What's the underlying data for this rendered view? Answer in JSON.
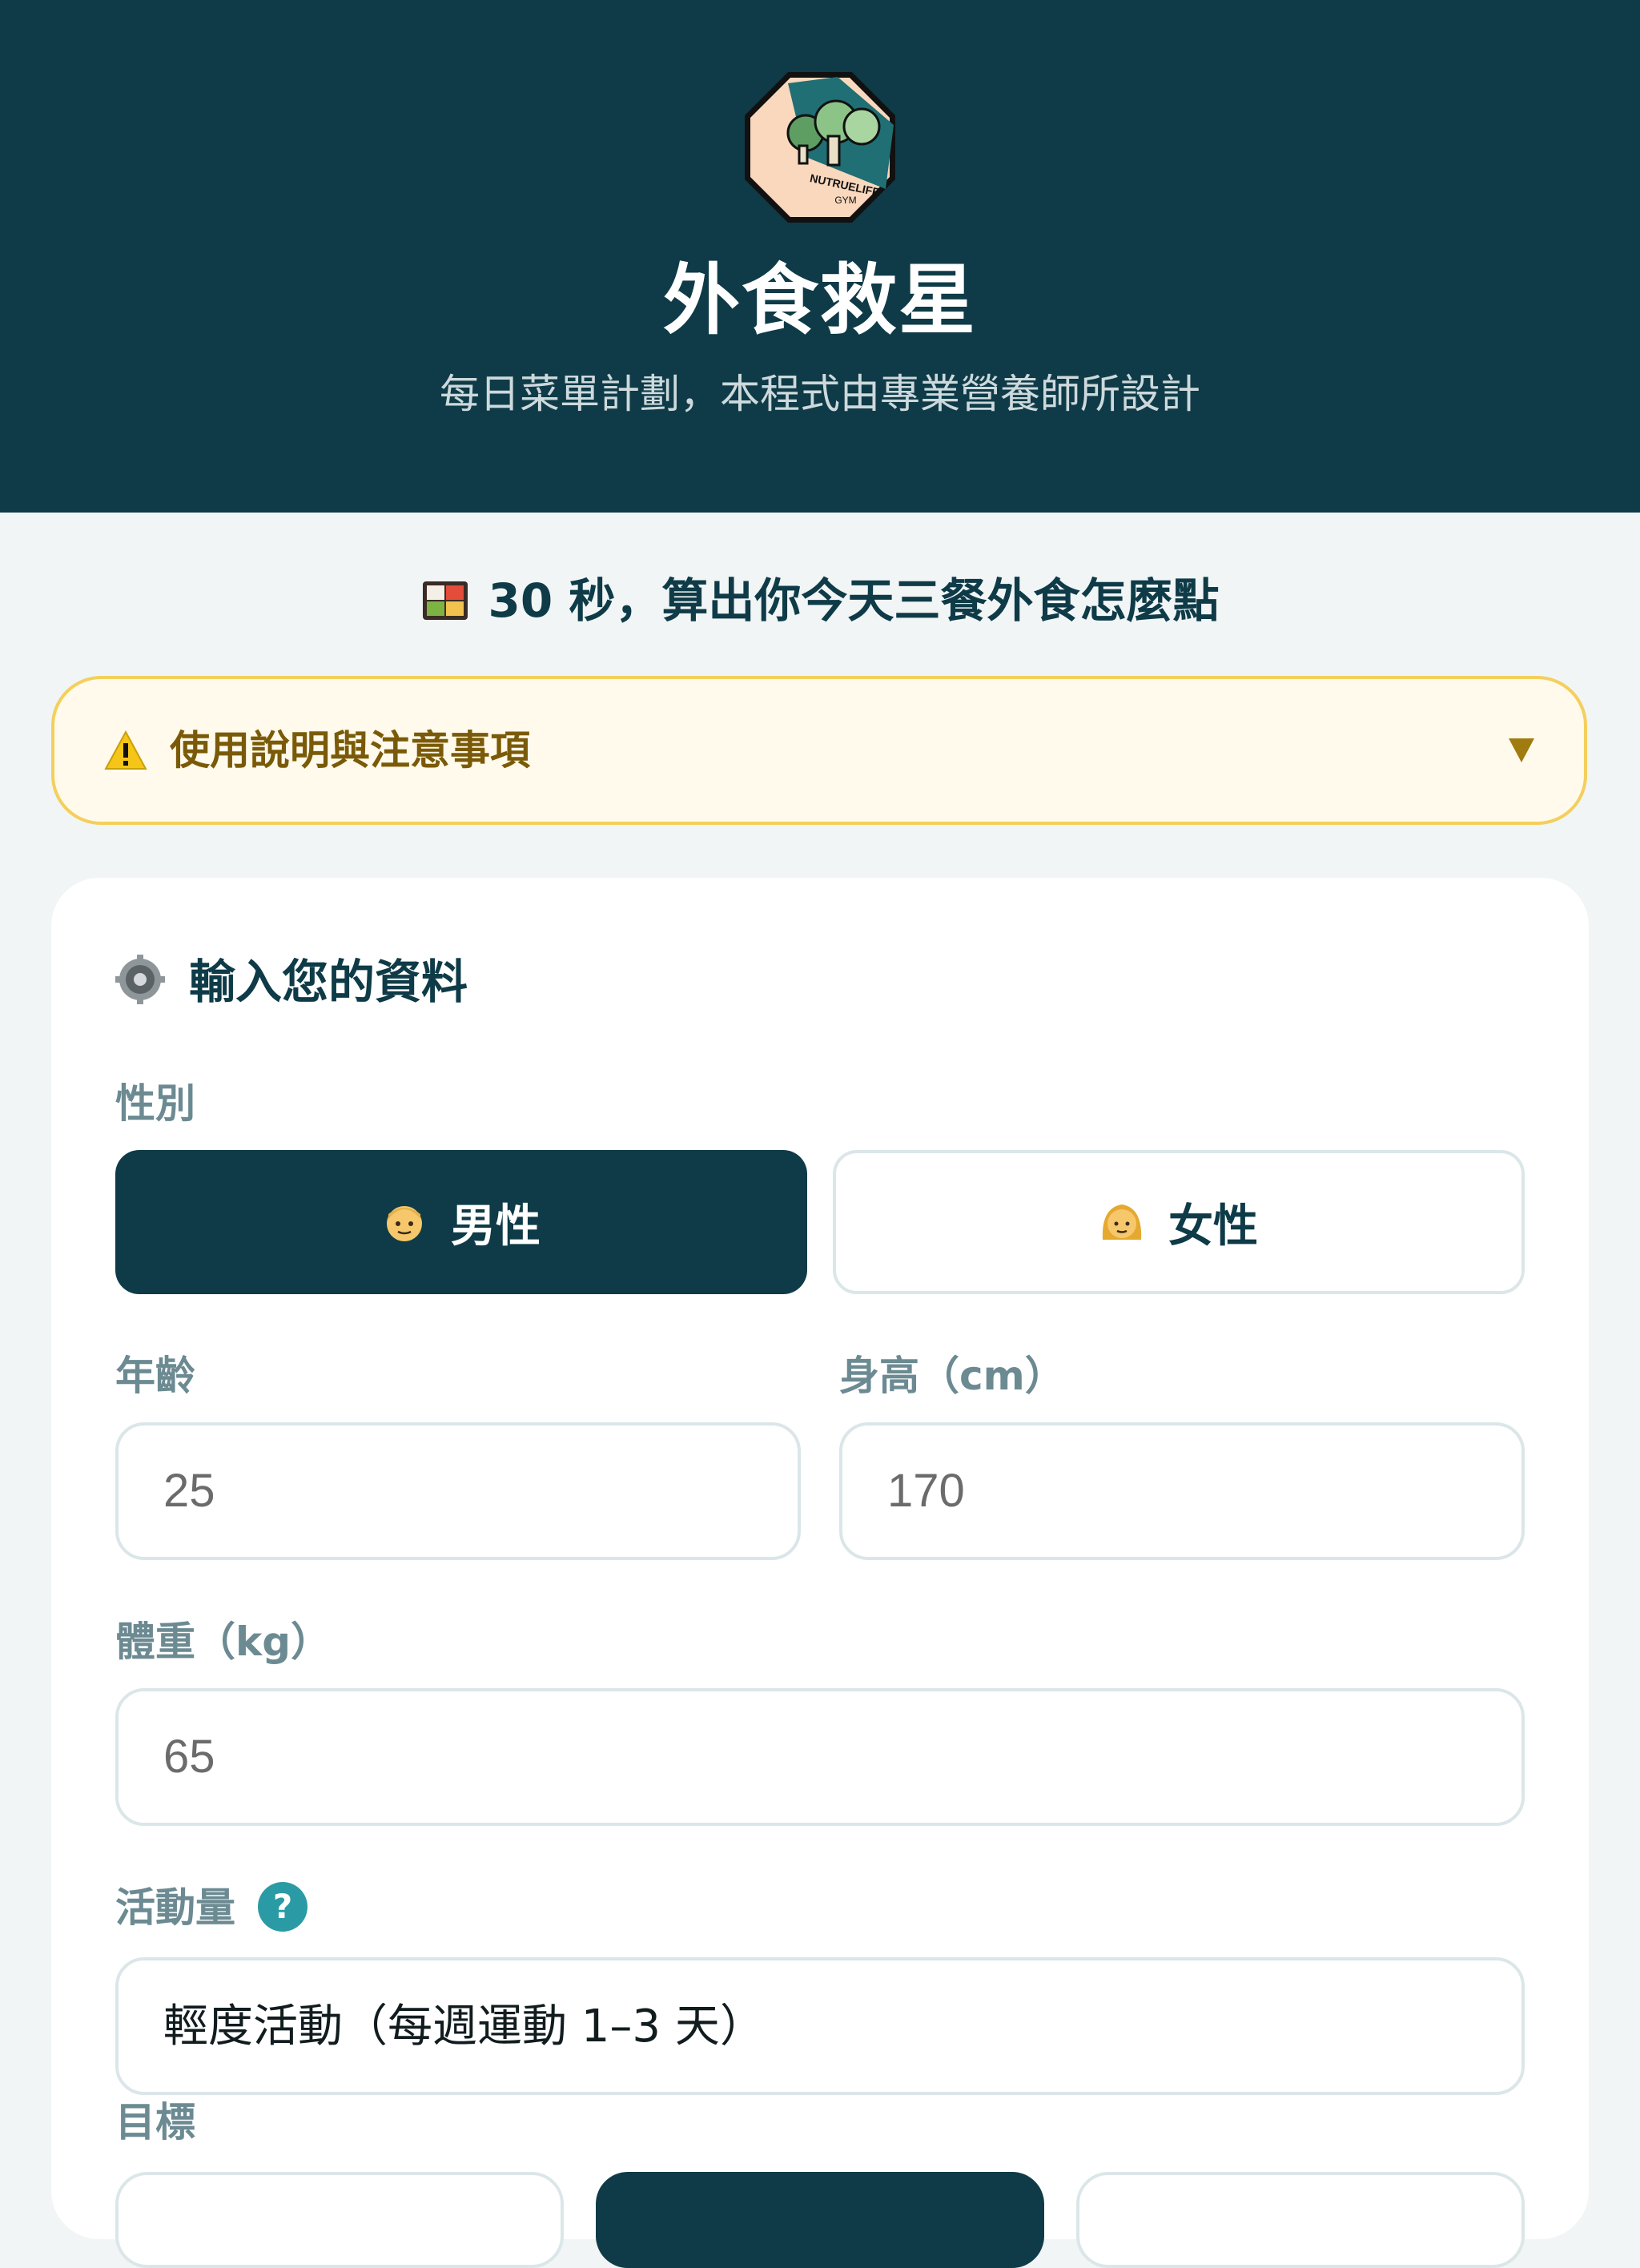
{
  "header": {
    "logo_text": "NUTRUELIFE GYM",
    "title": "外食救星",
    "subtitle": "每日菜單計劃，本程式由專業營養師所設計"
  },
  "headline": {
    "icon": "bento-box-icon",
    "text": "30 秒，算出你今天三餐外食怎麼點"
  },
  "notice": {
    "icon": "warning-icon",
    "label": "使用說明與注意事項",
    "expanded": false
  },
  "form": {
    "title": "輸入您的資料",
    "title_icon": "gear-icon",
    "gender": {
      "label": "性別",
      "options": [
        {
          "icon": "man-icon",
          "label": "男性",
          "selected": true
        },
        {
          "icon": "woman-icon",
          "label": "女性",
          "selected": false
        }
      ]
    },
    "age": {
      "label": "年齡",
      "placeholder": "25"
    },
    "height": {
      "label": "身高（cm）",
      "placeholder": "170"
    },
    "weight": {
      "label": "體重（kg）",
      "placeholder": "65"
    },
    "activity": {
      "label": "活動量",
      "help": "?",
      "value": "輕度活動（每週運動 1–3 天）"
    },
    "goal": {
      "label": "目標"
    }
  },
  "colors": {
    "primary": "#0e3b47",
    "accent": "#2a9ba4",
    "warning_bg": "#fffaeb",
    "warning_border": "#f4cf5c"
  }
}
